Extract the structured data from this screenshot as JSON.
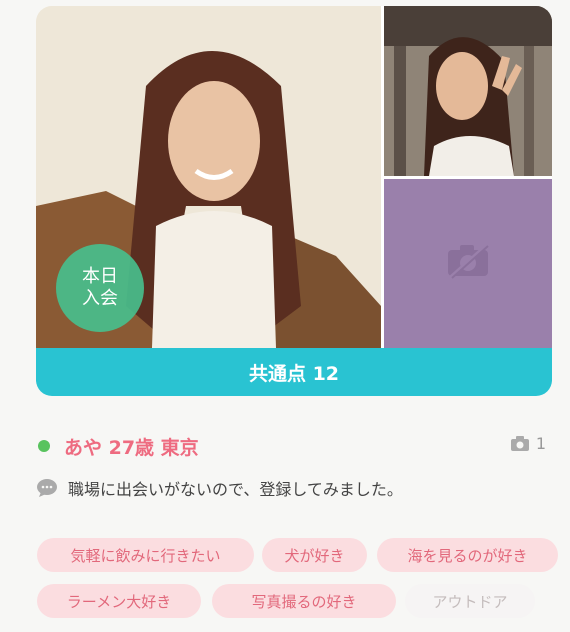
{
  "badge": {
    "line1": "本日",
    "line2": "入会"
  },
  "common": {
    "label": "共通点 12"
  },
  "profile": {
    "name_age_area": "あや 27歳 東京",
    "photo_count": "1"
  },
  "message": "職場に出会いがないので、登録してみました。",
  "tags": [
    {
      "label": "気軽に飲みに行きたい",
      "common": true
    },
    {
      "label": "犬が好き",
      "common": true
    },
    {
      "label": "海を見るのが好き",
      "common": true
    },
    {
      "label": "ラーメン大好き",
      "common": true
    },
    {
      "label": "写真撮るの好き",
      "common": true
    },
    {
      "label": "アウトドア",
      "common": false
    }
  ],
  "colors": {
    "accent_teal": "#29c3d2",
    "name_pink": "#ee6b80",
    "online_green": "#59c35e",
    "badge_green": "#48be8c",
    "tag_pink_bg": "#fbdde0",
    "placeholder_purple": "#9a80ab"
  },
  "icons": {
    "photo_count": "camera-icon",
    "message": "speech-bubble-icon",
    "placeholder": "no-photo-icon"
  }
}
